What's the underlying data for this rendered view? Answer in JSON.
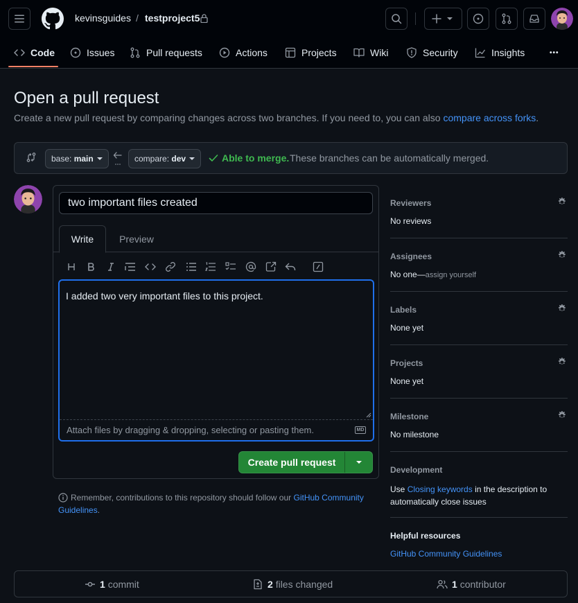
{
  "header": {
    "owner": "kevinsguides",
    "separator": "/",
    "repo": "testproject5"
  },
  "nav": {
    "tabs": [
      {
        "label": "Code",
        "icon": "code-icon",
        "active": true
      },
      {
        "label": "Issues",
        "icon": "issue-icon"
      },
      {
        "label": "Pull requests",
        "icon": "pull-request-icon"
      },
      {
        "label": "Actions",
        "icon": "play-icon"
      },
      {
        "label": "Projects",
        "icon": "table-icon"
      },
      {
        "label": "Wiki",
        "icon": "book-icon"
      },
      {
        "label": "Security",
        "icon": "shield-icon"
      },
      {
        "label": "Insights",
        "icon": "graph-icon"
      }
    ],
    "more": "•••"
  },
  "page": {
    "title": "Open a pull request",
    "subtitle": "Create a new pull request by comparing changes across two branches. If you need to, you can also ",
    "subtitle_link": "compare across forks",
    "subtitle_end": "."
  },
  "range": {
    "base_prefix": "base: ",
    "base_branch": "main",
    "compare_prefix": "compare: ",
    "compare_branch": "dev",
    "merge_status": "Able to merge.",
    "merge_detail": "These branches can be automatically merged."
  },
  "form": {
    "title_value": "two important files created",
    "tab_write": "Write",
    "tab_preview": "Preview",
    "body_text": "I added two very important files to this project.",
    "attach_hint": "Attach files by dragging & dropping, selecting or pasting them.",
    "markdown_badge": "MD",
    "submit_label": "Create pull request"
  },
  "notice": {
    "text": "Remember, contributions to this repository should follow our ",
    "link": "GitHub Community Guidelines",
    "end": "."
  },
  "sidebar": {
    "reviewers_title": "Reviewers",
    "reviewers_value": "No reviews",
    "assignees_title": "Assignees",
    "assignees_value": "No one—",
    "assignees_link": "assign yourself",
    "labels_title": "Labels",
    "labels_value": "None yet",
    "projects_title": "Projects",
    "projects_value": "None yet",
    "milestone_title": "Milestone",
    "milestone_value": "No milestone",
    "development_title": "Development",
    "development_pre": "Use ",
    "development_link": "Closing keywords",
    "development_post": " in the description to",
    "development_line2": "automatically close issues",
    "helpful_title": "Helpful resources",
    "helpful_link": "GitHub Community Guidelines"
  },
  "footer": {
    "commits_count": "1",
    "commits_label": "commit",
    "files_count": "2",
    "files_label": "files changed",
    "contributors_count": "1",
    "contributors_label": "contributor"
  },
  "colors": {
    "accent_green": "#238636",
    "link_blue": "#4493f8",
    "merge_green": "#3fb950",
    "nav_underline": "#f78166"
  }
}
